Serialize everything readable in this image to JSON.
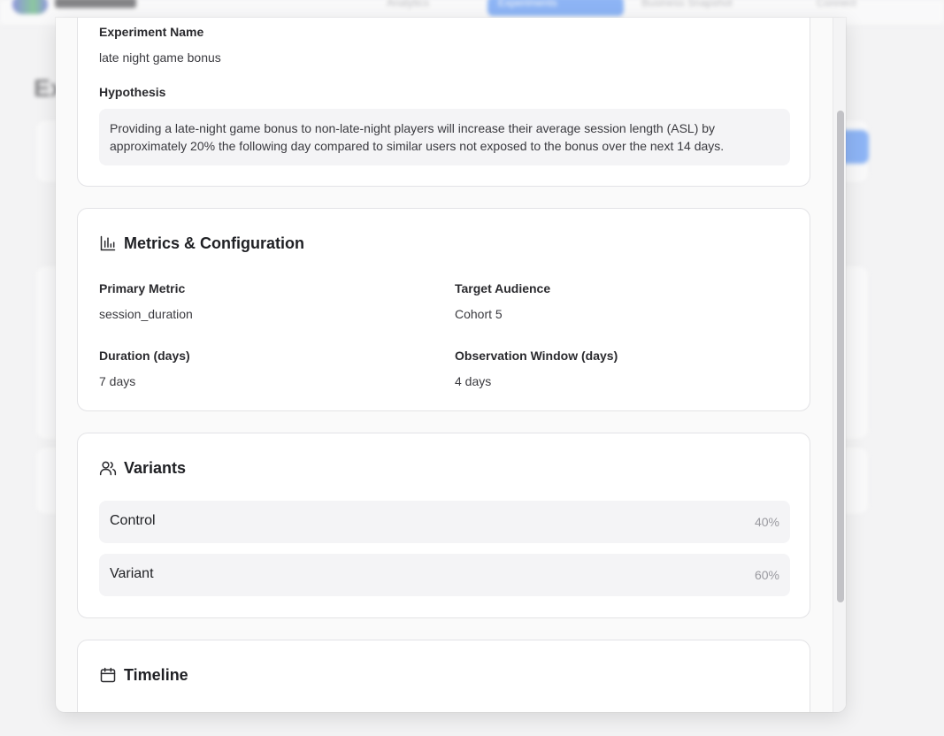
{
  "background": {
    "nav": [
      "Analytics",
      "Experiments",
      "Business Snapshot",
      "Connect"
    ],
    "page_title": "Ex"
  },
  "modal": {
    "basic": {
      "name_label": "Experiment Name",
      "name_value": "late night game bonus",
      "hypothesis_label": "Hypothesis",
      "hypothesis_line1": "Providing a late-night game bonus to non-late-night players will increase their average session length (ASL) by",
      "hypothesis_line2": "approximately 20% the following day compared to similar users not exposed to the bonus over the next 14 days."
    },
    "metrics": {
      "title": "Metrics & Configuration",
      "icon": "bar-chart-icon",
      "primary_metric_label": "Primary Metric",
      "primary_metric_value": "session_duration",
      "target_audience_label": "Target Audience",
      "target_audience_value": "Cohort 5",
      "duration_label": "Duration (days)",
      "duration_value": "7 days",
      "observation_label": "Observation Window (days)",
      "observation_value": "4 days"
    },
    "variants": {
      "title": "Variants",
      "icon": "users-icon",
      "items": [
        {
          "name": "Control",
          "allocation": "40%"
        },
        {
          "name": "Variant",
          "allocation": "60%"
        }
      ]
    },
    "timeline": {
      "title": "Timeline",
      "icon": "calendar-icon"
    }
  },
  "colors": {
    "accent": "#3b82f6",
    "card_bg": "#ffffff",
    "muted_bg": "#f4f4f6"
  }
}
